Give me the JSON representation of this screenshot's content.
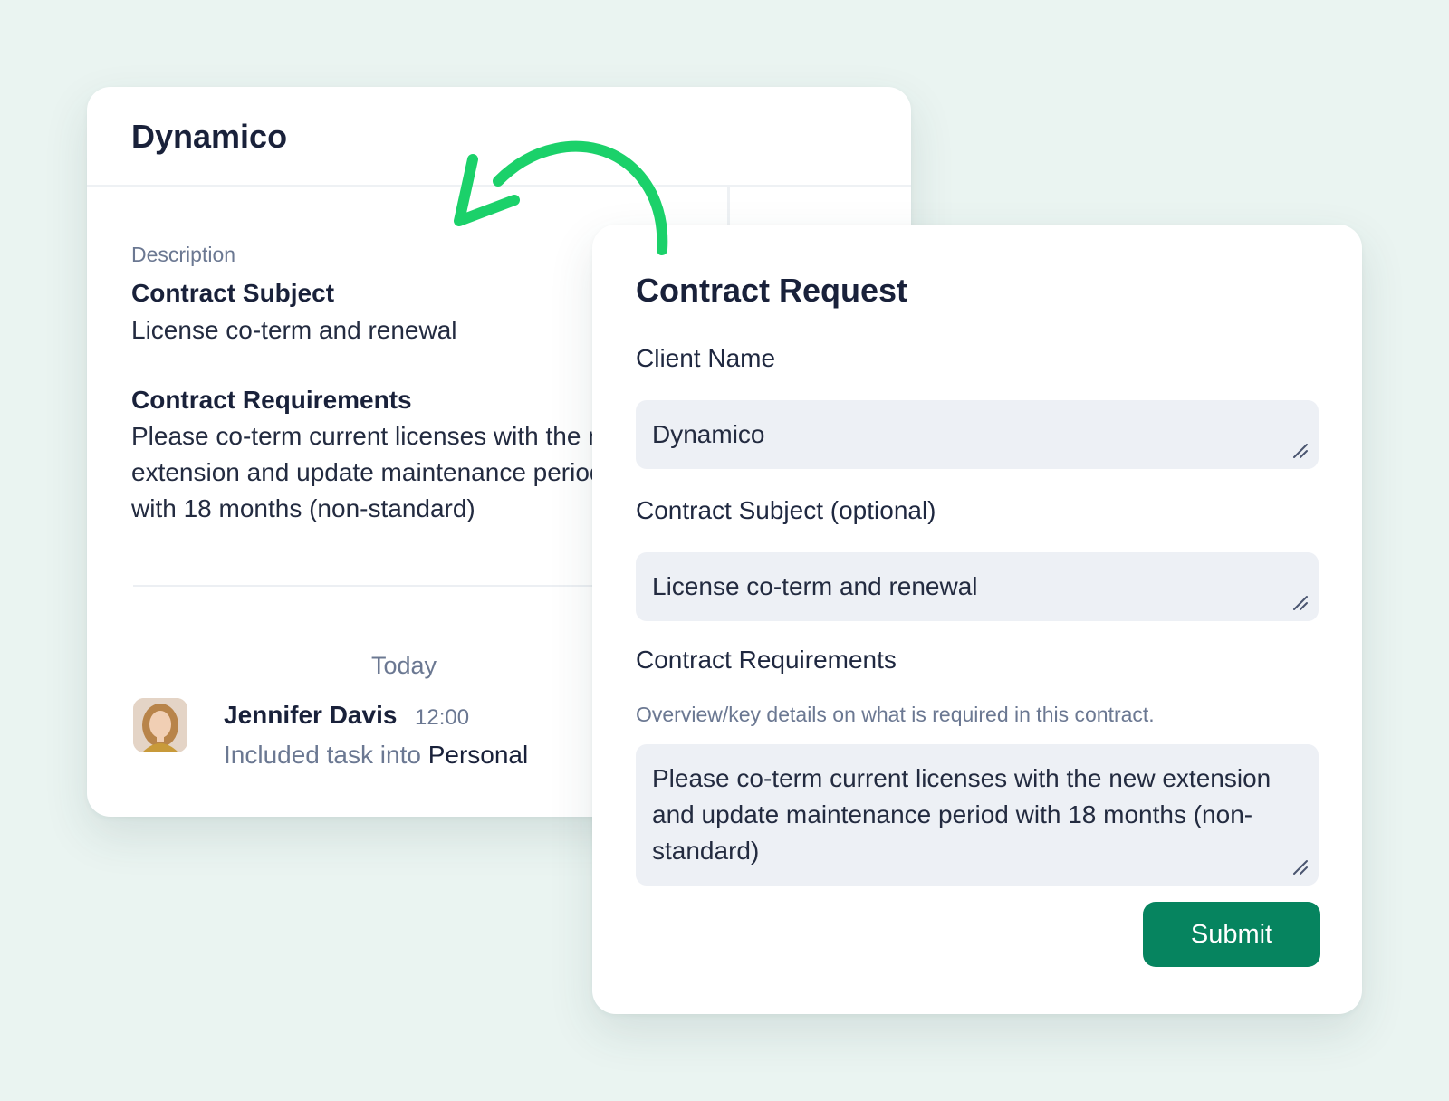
{
  "task_card": {
    "title": "Dynamico",
    "description_label": "Description",
    "subject_heading": "Contract Subject",
    "subject_text": "License co-term and renewal",
    "requirements_heading": "Contract Requirements",
    "requirements_text": "Please co-term current licenses with the new extension and update maintenance period with 18 months (non-standard)",
    "activity": {
      "date_label": "Today",
      "user_name": "Jennifer Davis",
      "time": "12:00",
      "action_text": "Included task into",
      "action_target": "Personal"
    }
  },
  "form_card": {
    "title": "Contract Request",
    "client_name_label": "Client Name",
    "client_name_value": "Dynamico",
    "subject_label": "Contract Subject (optional)",
    "subject_value": "License co-term and renewal",
    "requirements_label": "Contract Requirements",
    "requirements_help": "Overview/key details on what is required in this contract.",
    "requirements_value": "Please co-term current licenses with the new extension and update maintenance period with 18 months (non-standard)",
    "submit_label": "Submit"
  },
  "colors": {
    "background": "#eaf4f1",
    "accent_button": "#06845f",
    "arrow": "#1bd16a",
    "field_bg": "#edf0f5",
    "muted_text": "#6b7892"
  },
  "icons": [
    "resize-handle-icon",
    "curved-arrow-icon",
    "avatar"
  ]
}
